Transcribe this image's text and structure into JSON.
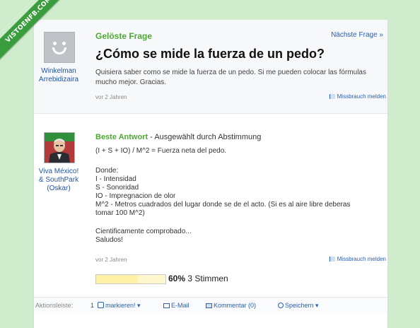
{
  "watermark": "VISTOENFB.COM",
  "question": {
    "status": "Gelöste Frage",
    "next_link": "Nächste Frage »",
    "title": "¿Cómo se mide la fuerza de un pedo?",
    "body": "Quisiera saber como se mide la fuerza de un pedo. Si me pueden colocar las fórmulas mucho mejor. Gracias.",
    "user_line1": "Winkelman",
    "user_line2": "Arrebidizaira",
    "time": "vor 2 Jahren",
    "report": "Missbrauch melden"
  },
  "answer": {
    "label": "Beste Antwort",
    "selected_by": " - Ausgewählt durch Abstimmung",
    "formula": "(I + S + IO) / M^2 = Fuerza neta del pedo.",
    "donde": "Donde:",
    "items": [
      "I - Intensidad",
      "S - Sonoridad",
      "IO - Impregnacion de olor",
      "M^2 - Metros cuadrados del lugar donde se de el acto. (Si es al aire libre deberas",
      "tomar 100 M^2)"
    ],
    "closing1": "Cientificamente comprobado...",
    "closing2": "Saludos!",
    "user_line1": "Viva México!",
    "user_line2": "& SouthPark",
    "user_line3": "(Oskar)",
    "time": "vor 2 Jahren",
    "report": "Missbrauch melden",
    "vote_fraction": 0.6,
    "vote_percent": "60%",
    "vote_count": "3 Stimmen"
  },
  "actions": {
    "label": "Aktionsleiste:",
    "star_count": "1",
    "mark": "markieren!",
    "email": "E-Mail",
    "comment": "Kommentar (0)",
    "save": "Speichern"
  },
  "colors": {
    "background": "#cfeccd",
    "green_heading": "#4ea832",
    "link_blue": "#2a5fb1",
    "watermark": "#3a9d3d"
  }
}
